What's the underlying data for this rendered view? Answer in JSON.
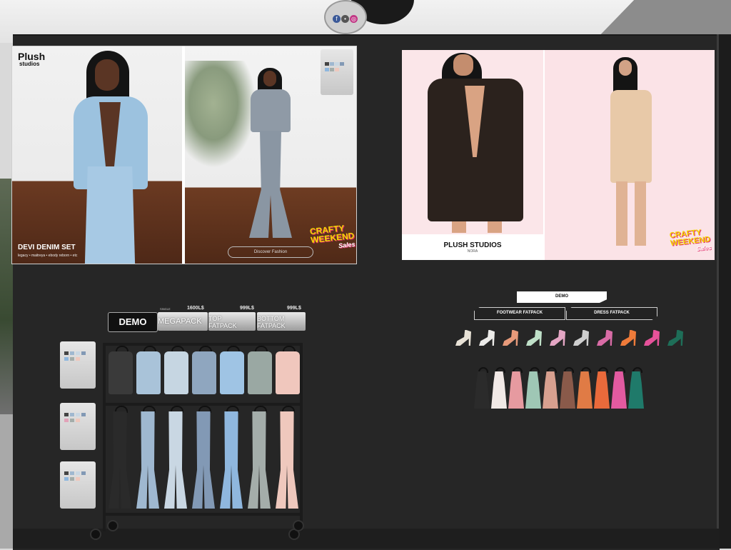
{
  "left_poster": {
    "logo_main": "Plush",
    "logo_sub": "studios",
    "product_name": "DEVI DENIM SET",
    "product_sub": "legacy • maitreya • ebody reborn • etc",
    "sale_badge_line1": "CRAFTY",
    "sale_badge_line2": "WEEKEND",
    "sale_badge_line3": "Sales",
    "search_pill": "Discover Fashion"
  },
  "right_poster": {
    "brand": "PLUSH STUDIOS",
    "brand_sub": "NORA",
    "sale_badge_line1": "CRAFTY",
    "sale_badge_line2": "WEEKEND",
    "sale_badge_line3": "Sales"
  },
  "denim_vendor": {
    "demo_label": "DEMO",
    "megapack_price": "1600L$",
    "megapack_label": "MEGAPACK",
    "megapack_tag": "SINGLE",
    "top_price": "999L$",
    "top_label_1": "TOP",
    "top_label_2": "FATPACK",
    "bottom_price": "999L$",
    "bottom_label_1": "BOTTOM",
    "bottom_label_2": "FATPACK"
  },
  "right_vendor": {
    "demo_label": "DEMO",
    "footwear_label": "FOOTWEAR FATPACK",
    "dress_label": "DRESS FATPACK"
  },
  "colors": {
    "wall": "#262626",
    "jackets": [
      "#3a3a3a",
      "#a9c3d9",
      "#c6d6e2",
      "#8fa6bf",
      "#9fc4e4",
      "#9aa8a3",
      "#f0c7bd"
    ],
    "jeans": [
      "#2a2a2a",
      "#9fb8d0",
      "#c9d7e3",
      "#8299b5",
      "#8fb7de",
      "#a4adaa",
      "#efc8bd"
    ],
    "shoes": [
      "#e8e2d6",
      "#ecebe9",
      "#e79a7a",
      "#bfe0c8",
      "#e4a6c4",
      "#cfcfcf",
      "#d96ca6",
      "#ef7b3a",
      "#e6529a",
      "#1e6e58"
    ],
    "dresses": [
      "#2b2b2b",
      "#f1e9e6",
      "#e69aa0",
      "#9fc7b5",
      "#d8a08f",
      "#8a5a4a",
      "#e07b45",
      "#e96a3b",
      "#e25aa0",
      "#1f7a6a"
    ]
  }
}
